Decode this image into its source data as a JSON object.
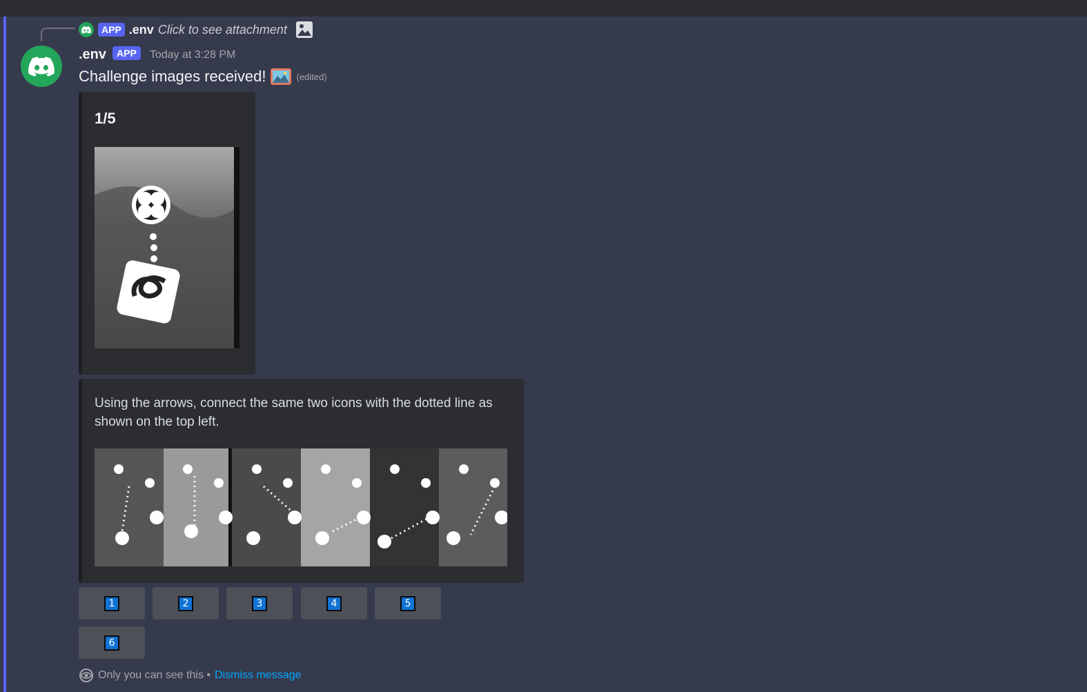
{
  "reply": {
    "badge": "APP",
    "name": ".env",
    "text": "Click to see attachment",
    "icons": [
      "discord-logo-icon",
      "image-icon"
    ]
  },
  "message": {
    "author": ".env",
    "badge": "APP",
    "timestamp": "Today at 3:28 PM",
    "content": "Challenge images received!",
    "edited": "(edited)"
  },
  "embed_challenge": {
    "title": "1/5"
  },
  "embed_instructions": {
    "description": "Using the arrows, connect the same two icons with the dotted line as shown on the top left."
  },
  "buttons": [
    "1",
    "2",
    "3",
    "4",
    "5",
    "6"
  ],
  "footer": {
    "notice": "Only you can see this •",
    "dismiss": "Dismiss message",
    "icon": "eye-icon"
  },
  "colors": {
    "background": "#363a4d",
    "embed": "#2b2d31",
    "accent": "#5865f2",
    "avatar": "#23a55a",
    "link": "#00a8fc",
    "keycap": "#1173d4"
  }
}
